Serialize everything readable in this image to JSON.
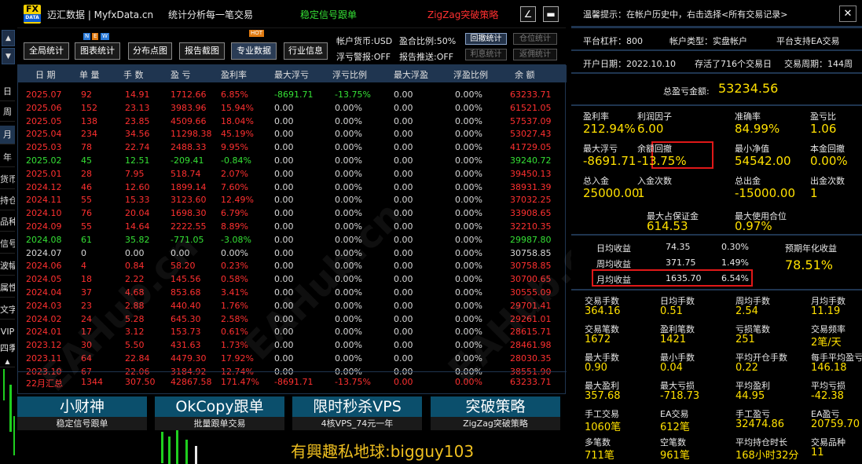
{
  "header": {
    "logo_top": "FX",
    "logo_bottom": "DATA",
    "site": "迈汇数据 | MyfxData.cn",
    "slogan": "统计分析每一笔交易",
    "strategy_green": "稳定信号跟单",
    "strategy_red": "ZigZag突破策略",
    "edit_label": "∠",
    "min_label": "▬"
  },
  "stepper": {
    "up": "▲",
    "down": "▼"
  },
  "side_tabs": [
    "日",
    "周",
    "月",
    "年",
    "货币",
    "持仓",
    "品种",
    "信号",
    "波幅",
    "属性",
    "文字",
    "VIP",
    "四季"
  ],
  "side_more": "▲",
  "toolbar": {
    "buttons": [
      "全局统计",
      "图表统计",
      "分布点图",
      "报告截图",
      "专业数据",
      "行业信息"
    ],
    "new_badge": [
      "N",
      "E",
      "W"
    ],
    "hot_badge": "HOT",
    "currency": "帐户货币:USD",
    "ratio": "盈合比例:50%",
    "float_warn": "浮亏警报:OFF",
    "report_push": "报告推送:OFF",
    "mode_buttons": [
      "回撤统计",
      "仓位统计",
      "利息统计",
      "返佣统计"
    ]
  },
  "table": {
    "headers": [
      "日 期",
      "单 量",
      "手 数",
      "盈 亏",
      "盈利率",
      "最大浮亏",
      "浮亏比例",
      "最大浮盈",
      "浮盈比例",
      "余 额"
    ],
    "rows": [
      [
        "2025.07",
        "92",
        "14.91",
        "1712.66",
        "6.85%",
        "-8691.71",
        "-13.75%",
        "0.00",
        "0.00%",
        "63233.71",
        "red"
      ],
      [
        "2025.06",
        "152",
        "23.13",
        "3983.96",
        "15.94%",
        "0.00",
        "0.00%",
        "0.00",
        "0.00%",
        "61521.05",
        "red"
      ],
      [
        "2025.05",
        "138",
        "23.85",
        "4509.66",
        "18.04%",
        "0.00",
        "0.00%",
        "0.00",
        "0.00%",
        "57537.09",
        "red"
      ],
      [
        "2025.04",
        "234",
        "34.56",
        "11298.38",
        "45.19%",
        "0.00",
        "0.00%",
        "0.00",
        "0.00%",
        "53027.43",
        "red"
      ],
      [
        "2025.03",
        "78",
        "22.74",
        "2488.33",
        "9.95%",
        "0.00",
        "0.00%",
        "0.00",
        "0.00%",
        "41729.05",
        "red"
      ],
      [
        "2025.02",
        "45",
        "12.51",
        "-209.41",
        "-0.84%",
        "0.00",
        "0.00%",
        "0.00",
        "0.00%",
        "39240.72",
        "grn"
      ],
      [
        "2025.01",
        "28",
        "7.95",
        "518.74",
        "2.07%",
        "0.00",
        "0.00%",
        "0.00",
        "0.00%",
        "39450.13",
        "red"
      ],
      [
        "2024.12",
        "46",
        "12.60",
        "1899.14",
        "7.60%",
        "0.00",
        "0.00%",
        "0.00",
        "0.00%",
        "38931.39",
        "red"
      ],
      [
        "2024.11",
        "55",
        "15.33",
        "3123.60",
        "12.49%",
        "0.00",
        "0.00%",
        "0.00",
        "0.00%",
        "37032.25",
        "red"
      ],
      [
        "2024.10",
        "76",
        "20.04",
        "1698.30",
        "6.79%",
        "0.00",
        "0.00%",
        "0.00",
        "0.00%",
        "33908.65",
        "red"
      ],
      [
        "2024.09",
        "55",
        "14.64",
        "2222.55",
        "8.89%",
        "0.00",
        "0.00%",
        "0.00",
        "0.00%",
        "32210.35",
        "red"
      ],
      [
        "2024.08",
        "61",
        "35.82",
        "-771.05",
        "-3.08%",
        "0.00",
        "0.00%",
        "0.00",
        "0.00%",
        "29987.80",
        "grn"
      ],
      [
        "2024.07",
        "0",
        "0.00",
        "0.00",
        "0.00%",
        "0.00",
        "0.00%",
        "0.00",
        "0.00%",
        "30758.85",
        "wht"
      ],
      [
        "2024.06",
        "4",
        "0.84",
        "58.20",
        "0.23%",
        "0.00",
        "0.00%",
        "0.00",
        "0.00%",
        "30758.85",
        "red"
      ],
      [
        "2024.05",
        "18",
        "2.22",
        "145.56",
        "0.58%",
        "0.00",
        "0.00%",
        "0.00",
        "0.00%",
        "30700.65",
        "red"
      ],
      [
        "2024.04",
        "37",
        "4.68",
        "853.68",
        "3.41%",
        "0.00",
        "0.00%",
        "0.00",
        "0.00%",
        "30555.09",
        "red"
      ],
      [
        "2024.03",
        "23",
        "2.88",
        "440.40",
        "1.76%",
        "0.00",
        "0.00%",
        "0.00",
        "0.00%",
        "29701.41",
        "red"
      ],
      [
        "2024.02",
        "24",
        "5.28",
        "645.30",
        "2.58%",
        "0.00",
        "0.00%",
        "0.00",
        "0.00%",
        "29261.01",
        "red"
      ],
      [
        "2024.01",
        "17",
        "3.12",
        "153.73",
        "0.61%",
        "0.00",
        "0.00%",
        "0.00",
        "0.00%",
        "28615.71",
        "red"
      ],
      [
        "2023.12",
        "30",
        "5.50",
        "431.63",
        "1.73%",
        "0.00",
        "0.00%",
        "0.00",
        "0.00%",
        "28461.98",
        "red"
      ],
      [
        "2023.11",
        "64",
        "22.84",
        "4479.30",
        "17.92%",
        "0.00",
        "0.00%",
        "0.00",
        "0.00%",
        "28030.35",
        "red"
      ],
      [
        "2023.10",
        "67",
        "22.06",
        "3184.92",
        "12.74%",
        "0.00",
        "0.00%",
        "0.00",
        "0.00%",
        "38551.90",
        "red"
      ]
    ],
    "summary": [
      "22月汇总",
      "1344",
      "307.50",
      "42867.58",
      "171.47%",
      "-8691.71",
      "-13.75%",
      "0.00",
      "0.00%",
      "63233.71"
    ]
  },
  "promos": [
    {
      "title": "小财神",
      "sub": "稳定信号跟单"
    },
    {
      "title": "OkCopy跟单",
      "sub": "批量跟单交易"
    },
    {
      "title": "限时秒杀VPS",
      "sub": "4核VPS_74元一年"
    },
    {
      "title": "突破策略",
      "sub": "ZigZag突破策略"
    }
  ],
  "contact": "有興趣私地球:bigguy103",
  "watermark": "EAHub.cn",
  "right": {
    "tip": "温馨提示：在帐户历史中，右击选择<所有交易记录>",
    "close": "✕",
    "leverage": "平台杠杆：800",
    "account_type": "帐户类型：实盘帐户",
    "ea_support": "平台支持EA交易",
    "open_date": "开户日期：2022.10.10",
    "survived": "存活了716个交易日",
    "trade_period": "交易周期：144周",
    "total_profit_label": "总盈亏金额:",
    "total_profit": "53234.56",
    "stats1": [
      {
        "label": "盈利率",
        "value": "212.94%"
      },
      {
        "label": "利润因子",
        "value": "6.00"
      },
      {
        "label": "准确率",
        "value": "84.99%"
      },
      {
        "label": "盈亏比",
        "value": "1.06"
      }
    ],
    "stats2": [
      {
        "label": "最大浮亏",
        "value": "-8691.71"
      },
      {
        "label": "余额回撤",
        "value": "-13.75%"
      },
      {
        "label": "最小净值",
        "value": "54542.00"
      },
      {
        "label": "本金回撤",
        "value": "0.00%"
      }
    ],
    "stats3": [
      {
        "label": "总入金",
        "value": "25000.00"
      },
      {
        "label": "入金次数",
        "value": "1"
      },
      {
        "label": "总出金",
        "value": "-15000.00"
      },
      {
        "label": "出金次数",
        "value": "1"
      }
    ],
    "stats4": [
      {
        "label": "最大占保证金",
        "value": "614.53"
      },
      {
        "label": "最大使用合位",
        "value": "0.97%"
      }
    ],
    "daily": {
      "label": "日均收益",
      "value": "74.35",
      "pct": "0.30%"
    },
    "weekly": {
      "label": "周均收益",
      "value": "371.75",
      "pct": "1.49%"
    },
    "monthly": {
      "label": "月均收益",
      "value": "1635.70",
      "pct": "6.54%"
    },
    "annual_label": "预期年化收益",
    "annual_value": "78.51%",
    "grid": [
      [
        {
          "label": "交易手数",
          "value": "364.16"
        },
        {
          "label": "日均手数",
          "value": "0.51"
        },
        {
          "label": "周均手数",
          "value": "2.54"
        },
        {
          "label": "月均手数",
          "value": "11.19"
        }
      ],
      [
        {
          "label": "交易笔数",
          "value": "1672"
        },
        {
          "label": "盈利笔数",
          "value": "1421"
        },
        {
          "label": "亏损笔数",
          "value": "251"
        },
        {
          "label": "交易频率",
          "value": "2笔/天"
        }
      ],
      [
        {
          "label": "最大手数",
          "value": "0.90"
        },
        {
          "label": "最小手数",
          "value": "0.04"
        },
        {
          "label": "平均开仓手数",
          "value": "0.22"
        },
        {
          "label": "每手平均盈亏",
          "value": "146.18"
        }
      ],
      [
        {
          "label": "最大盈利",
          "value": "357.68"
        },
        {
          "label": "最大亏损",
          "value": "-718.73"
        },
        {
          "label": "平均盈利",
          "value": "44.95"
        },
        {
          "label": "平均亏损",
          "value": "-42.38"
        }
      ],
      [
        {
          "label": "手工交易",
          "value": "1060笔"
        },
        {
          "label": "EA交易",
          "value": "612笔"
        },
        {
          "label": "手工盈亏",
          "value": "32474.86"
        },
        {
          "label": "EA盈亏",
          "value": "20759.70"
        }
      ],
      [
        {
          "label": "多笔数",
          "value": "711笔"
        },
        {
          "label": "空笔数",
          "value": "961笔"
        },
        {
          "label": "平均持仓时长",
          "value": "168小时32分"
        },
        {
          "label": "交易品种",
          "value": "11"
        }
      ]
    ]
  }
}
